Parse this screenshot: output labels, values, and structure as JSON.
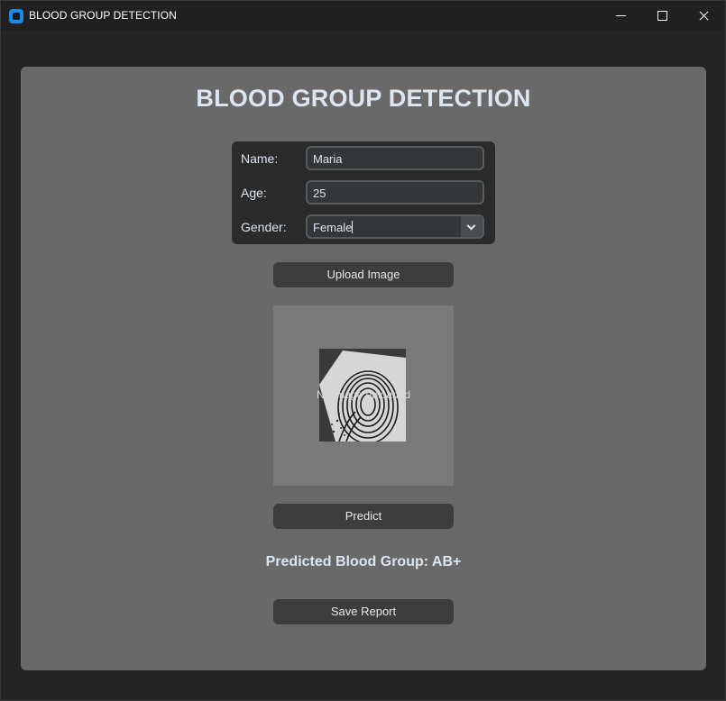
{
  "window": {
    "title": "BLOOD GROUP DETECTION"
  },
  "main": {
    "heading": "BLOOD GROUP DETECTION",
    "form": {
      "name_label": "Name:",
      "name_value": "Maria",
      "age_label": "Age:",
      "age_value": "25",
      "gender_label": "Gender:",
      "gender_value": "Female"
    },
    "upload_button": "Upload Image",
    "image_placeholder": "No image uploaded",
    "predict_button": "Predict",
    "result_text": "Predicted Blood Group: AB+",
    "save_button": "Save Report"
  },
  "colors": {
    "accent": "#1e88e5",
    "panel": "#696969",
    "button": "#3d3d3d"
  }
}
